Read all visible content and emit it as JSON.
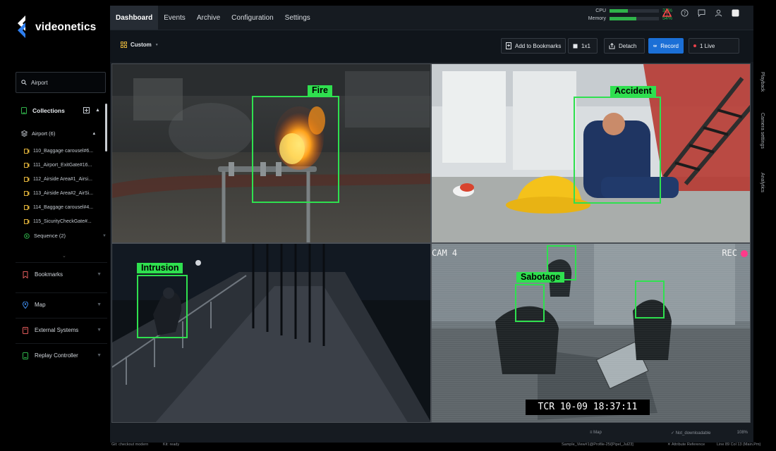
{
  "brand": {
    "name": "videonetics"
  },
  "sidebar": {
    "search": {
      "value": "Airport",
      "icon": "search-icon"
    },
    "collections": {
      "label": "Collections"
    },
    "group": {
      "label": "Airport (6)"
    },
    "cameras": [
      "110_Baggage carousel#6...",
      "111_Airport_ExitGate#16...",
      "112_Airside Area#1_Airsi...",
      "113_Airside Area#2_AirSi...",
      "114_Baggage carousel#4...",
      "115_SicurityCheckGate#..."
    ],
    "sequence": {
      "label": "Sequence (2)"
    },
    "sections": [
      {
        "label": "Bookmarks",
        "icon": "bookmark-icon",
        "color": "#e25b5b"
      },
      {
        "label": "Map",
        "icon": "map-pin-icon",
        "color": "#3f8ef0"
      },
      {
        "label": "External Systems",
        "icon": "external-systems-icon",
        "color": "#e25b5b"
      },
      {
        "label": "Replay Controller",
        "icon": "replay-controller-icon",
        "color": "#2fb34a"
      }
    ]
  },
  "topnav": {
    "tabs": [
      "Dashboard",
      "Events",
      "Archive",
      "Configuration",
      "Settings"
    ],
    "active": "Dashboard"
  },
  "system_monitor": {
    "cpu": {
      "label": "CPU",
      "value": "37%",
      "fraction": 0.37
    },
    "memory": {
      "label": "Memory",
      "value": "54%",
      "fraction": 0.54
    }
  },
  "toolbar": {
    "layout_label": "Custom",
    "add_bookmark": "Add to Bookmarks",
    "layout_1x1": "1x1",
    "detach": "Detach",
    "record": "Record",
    "live": "1 Live"
  },
  "feeds": {
    "fire": {
      "tag": "Fire"
    },
    "accident": {
      "tag": "Accident"
    },
    "intrusion": {
      "tag": "Intrusion"
    },
    "sabotage": {
      "tag": "Sabotage",
      "cam_label": "CAM 4",
      "rec_label": "REC",
      "timestamp": "TCR 10-09 18:37:11"
    }
  },
  "side_panels": [
    "Playback",
    "Camera settings",
    "Analytics"
  ],
  "statusbar": {
    "left": "108%",
    "mid": "✓ Not_downloadable",
    "right": "≡ Map"
  },
  "footer": {
    "left": "Git: checkout modern",
    "mid1": "Kit: ready",
    "mid2": "Sample_View#1@Profile-25/[Pipel_Jul23]",
    "mid3": "✕ Attribute Reference",
    "right": "Line 89 Col 13 (Main.Pm)"
  },
  "colors": {
    "accent": "#1b6fd6",
    "detection": "#2fe04f",
    "alert": "#e8414a",
    "ok": "#2fb34a"
  }
}
